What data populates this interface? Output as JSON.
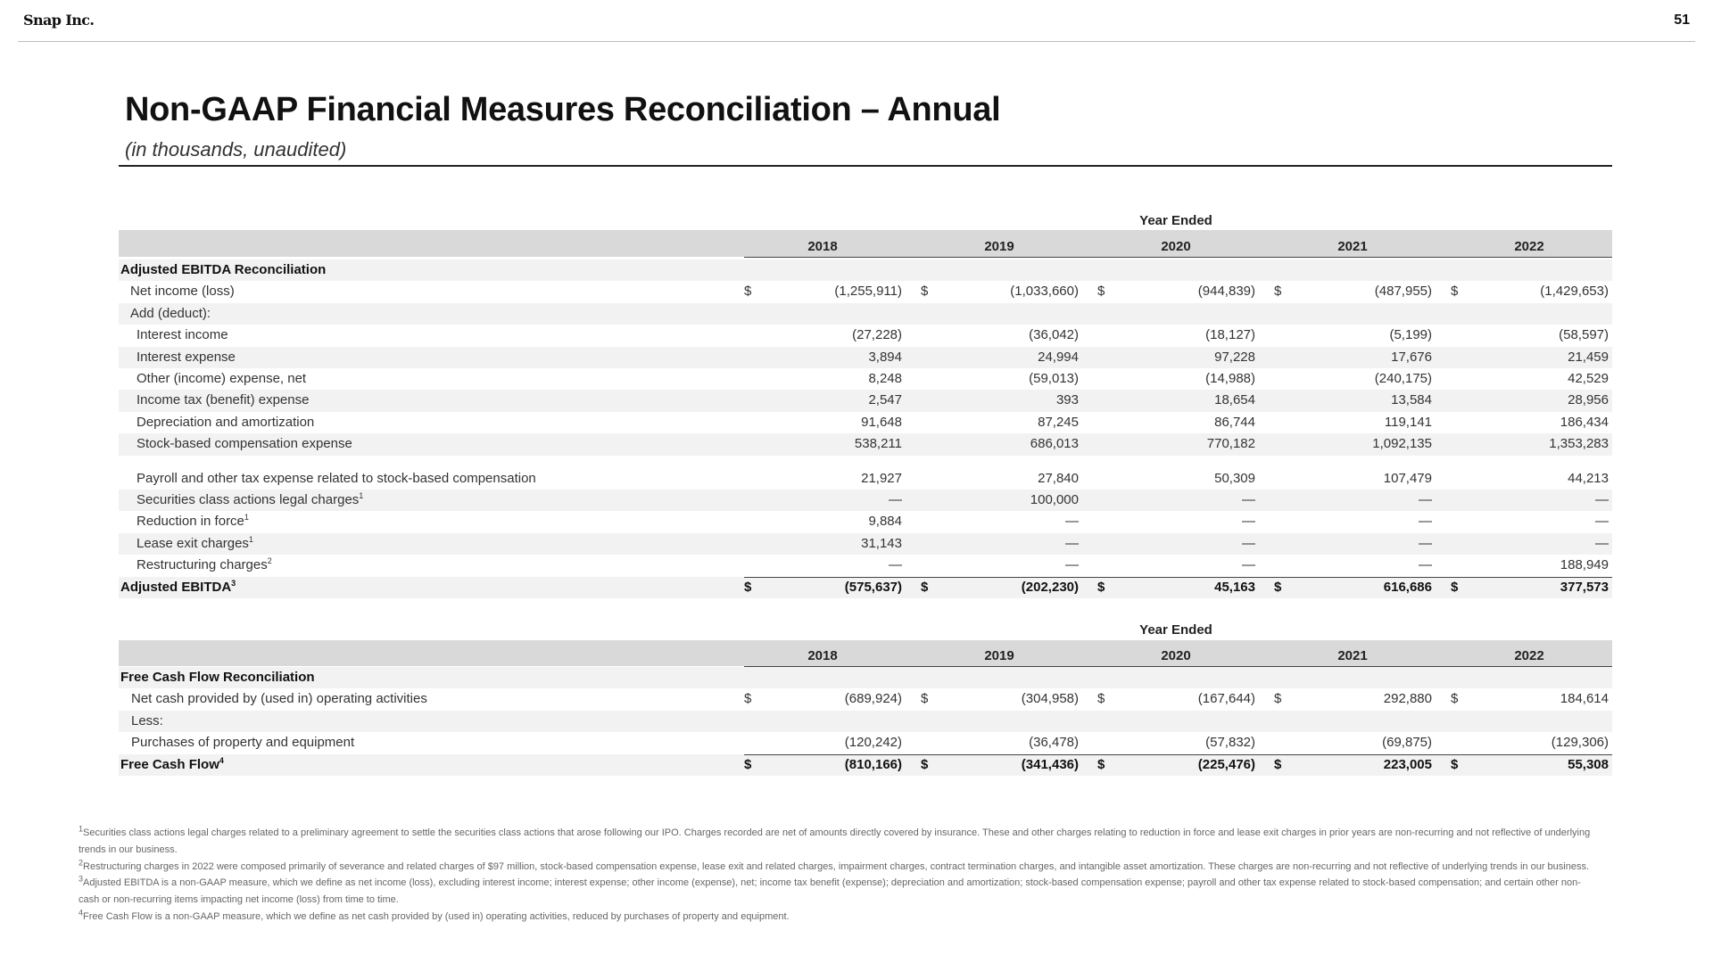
{
  "header": {
    "brand": "Snap Inc.",
    "page_number": "51"
  },
  "title": "Non-GAAP Financial Measures Reconciliation – Annual",
  "subtitle": "(in thousands, unaudited)",
  "columns": {
    "group_label": "Year Ended",
    "years": [
      "2018",
      "2019",
      "2020",
      "2021",
      "2022"
    ]
  },
  "ebitda": {
    "section_label": "Adjusted EBITDA Reconciliation",
    "rows": [
      {
        "label": "Net income (loss)",
        "values": [
          "(1,255,911)",
          "(1,033,660)",
          "(944,839)",
          "(487,955)",
          "(1,429,653)"
        ]
      },
      {
        "label": "Add (deduct):",
        "values": [
          "",
          "",
          "",
          "",
          ""
        ]
      },
      {
        "label": "Interest income",
        "values": [
          "(27,228)",
          "(36,042)",
          "(18,127)",
          "(5,199)",
          "(58,597)"
        ]
      },
      {
        "label": "Interest expense",
        "values": [
          "3,894",
          "24,994",
          "97,228",
          "17,676",
          "21,459"
        ]
      },
      {
        "label": "Other (income) expense, net",
        "values": [
          "8,248",
          "(59,013)",
          "(14,988)",
          "(240,175)",
          "42,529"
        ]
      },
      {
        "label": "Income tax (benefit) expense",
        "values": [
          "2,547",
          "393",
          "18,654",
          "13,584",
          "28,956"
        ]
      },
      {
        "label": "Depreciation and amortization",
        "values": [
          "91,648",
          "87,245",
          "86,744",
          "119,141",
          "186,434"
        ]
      },
      {
        "label": "Stock-based compensation expense",
        "values": [
          "538,211",
          "686,013",
          "770,182",
          "1,092,135",
          "1,353,283"
        ]
      },
      {
        "label": "Payroll and other tax expense related to stock-based compensation",
        "values": [
          "21,927",
          "27,840",
          "50,309",
          "107,479",
          "44,213"
        ]
      },
      {
        "label": "Securities class actions legal charges",
        "sup": "1",
        "values": [
          "—",
          "100,000",
          "—",
          "—",
          "—"
        ]
      },
      {
        "label": "Reduction in force",
        "sup": "1",
        "values": [
          "9,884",
          "—",
          "—",
          "—",
          "—"
        ]
      },
      {
        "label": "Lease exit charges",
        "sup": "1",
        "values": [
          "31,143",
          "—",
          "—",
          "—",
          "—"
        ]
      },
      {
        "label": "Restructuring charges",
        "sup": "2",
        "values": [
          "—",
          "—",
          "—",
          "—",
          "188,949"
        ]
      }
    ],
    "total": {
      "label": "Adjusted EBITDA",
      "sup": "3",
      "values": [
        "(575,637)",
        "(202,230)",
        "45,163",
        "616,686",
        "377,573"
      ]
    }
  },
  "fcf": {
    "section_label": "Free Cash Flow Reconciliation",
    "rows": [
      {
        "label": "Net cash provided by (used in) operating activities",
        "values": [
          "(689,924)",
          "(304,958)",
          "(167,644)",
          "292,880",
          "184,614"
        ]
      },
      {
        "label": "Less:",
        "values": [
          "",
          "",
          "",
          "",
          ""
        ]
      },
      {
        "label": "Purchases of property and equipment",
        "values": [
          "(120,242)",
          "(36,478)",
          "(57,832)",
          "(69,875)",
          "(129,306)"
        ]
      }
    ],
    "total": {
      "label": "Free Cash Flow",
      "sup": "4",
      "values": [
        "(810,166)",
        "(341,436)",
        "(225,476)",
        "223,005",
        "55,308"
      ]
    }
  },
  "currency_symbol": "$",
  "footnotes": [
    {
      "sup": "1",
      "text": "Securities class actions legal charges related to a preliminary agreement to settle the securities class actions that arose following our IPO. Charges recorded are net of amounts directly covered by insurance. These and other charges relating to reduction in force and lease exit charges in prior years are non-recurring and not reflective of underlying trends in our business."
    },
    {
      "sup": "2",
      "text": "Restructuring charges in 2022 were composed primarily of severance and related charges of $97 million, stock-based compensation expense, lease exit and related charges, impairment charges, contract termination charges, and intangible asset amortization. These charges are non-recurring and not reflective of underlying trends in our business."
    },
    {
      "sup": "3",
      "text": "Adjusted EBITDA is a non-GAAP measure, which we define as net income (loss), excluding interest income; interest expense; other income (expense), net; income tax benefit (expense); depreciation and amortization; stock-based compensation expense; payroll and other tax expense related to stock-based compensation; and certain other non-cash or non-recurring items impacting net income (loss) from time to time."
    },
    {
      "sup": "4",
      "text": "Free Cash Flow is a non-GAAP measure, which we define as net cash provided by (used in) operating activities, reduced by purchases of property and equipment."
    }
  ]
}
